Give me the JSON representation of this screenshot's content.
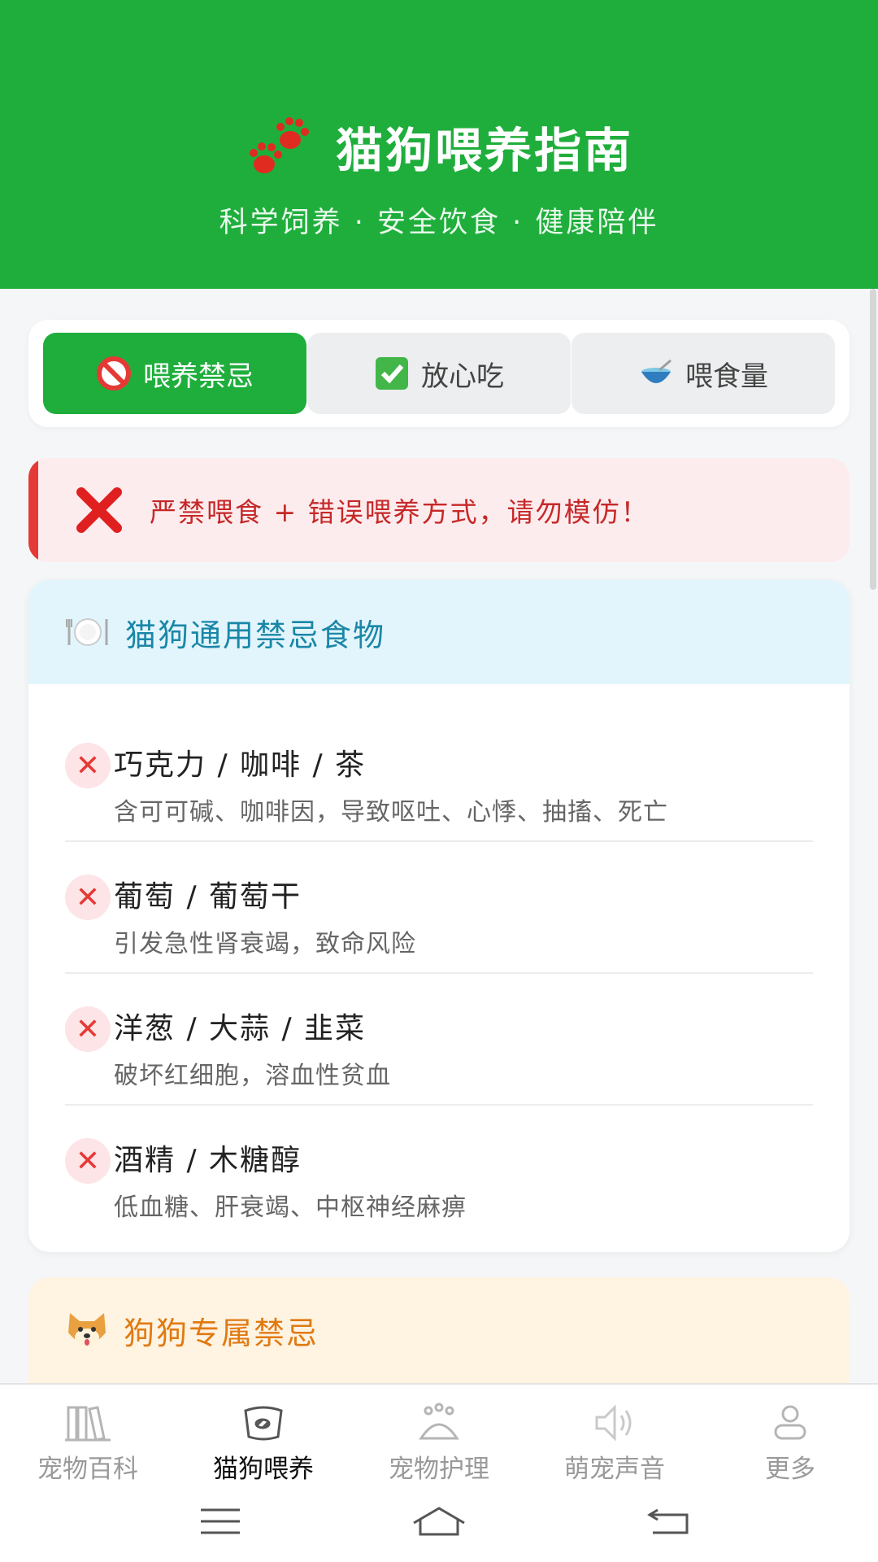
{
  "header": {
    "title": "猫狗喂养指南",
    "subtitle": "科学饲养 · 安全饮食 · 健康陪伴",
    "icon": "paw-icon"
  },
  "tabs": [
    {
      "label": "喂养禁忌",
      "icon": "prohibited-icon",
      "active": true
    },
    {
      "label": "放心吃",
      "icon": "check-mark-icon",
      "active": false
    },
    {
      "label": "喂食量",
      "icon": "bowl-icon",
      "active": false
    }
  ],
  "alert": {
    "text": "严禁喂食 + 错误喂养方式，请勿模仿！",
    "icon": "cross-icon"
  },
  "general_section": {
    "title": "猫狗通用禁忌食物",
    "icon": "plate-cutlery-icon",
    "items": [
      {
        "name": "巧克力 / 咖啡 / 茶",
        "desc": "含可可碱、咖啡因，导致呕吐、心悸、抽搐、死亡"
      },
      {
        "name": "葡萄 / 葡萄干",
        "desc": "引发急性肾衰竭，致命风险"
      },
      {
        "name": "洋葱 / 大蒜 / 韭菜",
        "desc": "破坏红细胞，溶血性贫血"
      },
      {
        "name": "酒精 / 木糖醇",
        "desc": "低血糖、肝衰竭、中枢神经麻痹"
      }
    ]
  },
  "dog_section": {
    "title": "狗狗专属禁忌",
    "icon": "dog-face-icon"
  },
  "bottom_nav": [
    {
      "label": "宠物百科",
      "icon": "books-icon",
      "active": false
    },
    {
      "label": "猫狗喂养",
      "icon": "food-bowl-icon",
      "active": true
    },
    {
      "label": "宠物护理",
      "icon": "paw-care-icon",
      "active": false
    },
    {
      "label": "萌宠声音",
      "icon": "speaker-icon",
      "active": false
    },
    {
      "label": "更多",
      "icon": "user-icon",
      "active": false
    }
  ],
  "colors": {
    "primary": "#1fae3c",
    "alert": "#e53935",
    "section_blue": "#1a87a8",
    "section_orange": "#e07a12"
  }
}
